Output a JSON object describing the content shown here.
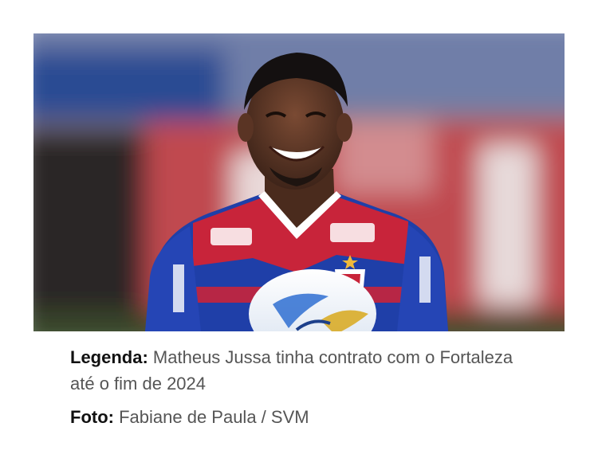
{
  "photo": {
    "subject": "smiling-football-player-photo",
    "colors": {
      "jersey_blue": "#1f3fa8",
      "jersey_red": "#c8243a",
      "background_red": "#c04a4f",
      "background_blue": "#2b4b93"
    }
  },
  "caption": {
    "label": "Legenda:",
    "text": "Matheus Jussa tinha contrato com o Fortaleza até o fim de 2024"
  },
  "credit": {
    "label": "Foto:",
    "text": "Fabiane de Paula / SVM"
  }
}
